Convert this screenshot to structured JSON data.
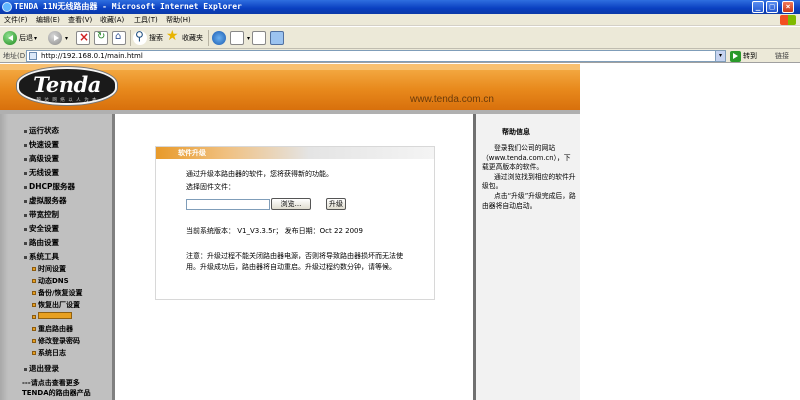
{
  "window": {
    "title": "TENDA 11N无线路由器 - Microsoft Internet Explorer",
    "buttons": [
      "_",
      "□",
      "×"
    ]
  },
  "menu": [
    "文件(F)",
    "编辑(E)",
    "查看(V)",
    "收藏(A)",
    "工具(T)",
    "帮助(H)"
  ],
  "toolbar": {
    "back_label": "后退",
    "search_label": "搜索",
    "favorites_label": "收藏夹",
    "dropdown_glyph": "▾"
  },
  "address": {
    "label": "地址(D)",
    "url": "http://192.168.0.1/main.html",
    "go_label": "转到",
    "links_label": "链接"
  },
  "banner": {
    "logo_text": "Tenda",
    "logo_sub": "腾 达 网 络 以 人 为 本",
    "website": "www.tenda.com.cn",
    "colors": {
      "primary": "#e8891c",
      "dark": "#d8700c"
    }
  },
  "nav": {
    "items": [
      {
        "label": "运行状态",
        "type": "main"
      },
      {
        "label": "快速设置",
        "type": "main"
      },
      {
        "label": "高级设置",
        "type": "main"
      },
      {
        "label": "无线设置",
        "type": "main"
      },
      {
        "label": "DHCP服务器",
        "type": "main"
      },
      {
        "label": "虚拟服务器",
        "type": "main"
      },
      {
        "label": "带宽控制",
        "type": "main"
      },
      {
        "label": "安全设置",
        "type": "main"
      },
      {
        "label": "路由设置",
        "type": "main"
      },
      {
        "label": "系统工具",
        "type": "main"
      },
      {
        "label": "时间设置",
        "type": "sub"
      },
      {
        "label": "动态DNS",
        "type": "sub"
      },
      {
        "label": "备份/恢复设置",
        "type": "sub"
      },
      {
        "label": "恢复出厂设置",
        "type": "sub"
      },
      {
        "label": "",
        "type": "sub",
        "active": true
      },
      {
        "label": "重启路由器",
        "type": "sub"
      },
      {
        "label": "修改登录密码",
        "type": "sub"
      },
      {
        "label": "系统日志",
        "type": "sub"
      },
      {
        "label": "退出登录",
        "type": "main"
      }
    ],
    "footer_line1": "---请点击查看更多",
    "footer_line2": "TENDA的路由器产品"
  },
  "upgrade": {
    "title": "软件升级",
    "line1": "通过升级本路由器的软件，您将获得新的功能。",
    "line2": "选择固件文件：",
    "browse_label": "浏览...",
    "upgrade_label": "升级",
    "version_line": "当前系统版本：  V1_V3.3.5r；  发布日期：Oct 22 2009",
    "note_line1": "注意：升级过程不能关闭路由器电源，否则将导致路由器损坏而无法使",
    "note_line2": "用。升级成功后，路由器将自动重启。升级过程约数分钟，请等候。"
  },
  "help": {
    "title": "帮助信息",
    "p1": "登录我们公司的网站（www.tenda.com.cn），下载更高版本的软件。",
    "p2": "通过浏览找到相应的软件升级包。",
    "p3": "点击“升级”升级完成后，路由器将自动启动。"
  }
}
